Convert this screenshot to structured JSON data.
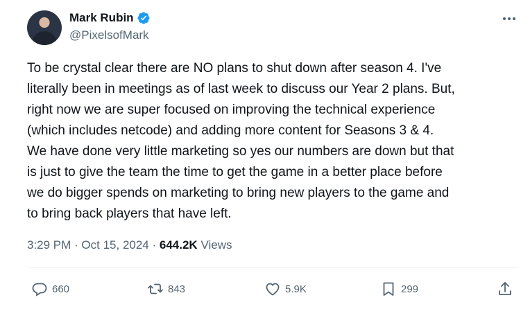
{
  "author": {
    "name": "Mark Rubin",
    "handle": "@PixelsofMark",
    "verified": true
  },
  "tweet": {
    "text": "To be crystal clear there are NO plans to shut down after season 4. I've\nliterally been in meetings as of last week to discuss our Year 2 plans. But,\nright now we are super focused on improving the technical experience\n(which includes netcode) and adding more content for Seasons 3 & 4.\nWe have done very little marketing so yes our numbers are down but that\nis just to give the team the time to get the game in a better place before\nwe do bigger spends on marketing to bring new players to the game and\nto bring back players that have left.",
    "time": "3:29 PM",
    "date": "Oct 15, 2024",
    "views_count": "644.2K",
    "views_label": "Views"
  },
  "actions": {
    "replies": "660",
    "reposts": "843",
    "likes": "5.9K",
    "bookmarks": "299"
  },
  "icons": {
    "more": "more-horizontal-icon",
    "verified": "verified-badge-icon",
    "reply": "reply-icon",
    "repost": "repost-icon",
    "like": "heart-icon",
    "bookmark": "bookmark-icon",
    "share": "share-icon"
  },
  "colors": {
    "verified_blue": "#1d9bf0",
    "secondary_text": "#536471",
    "primary_text": "#0f1419"
  }
}
